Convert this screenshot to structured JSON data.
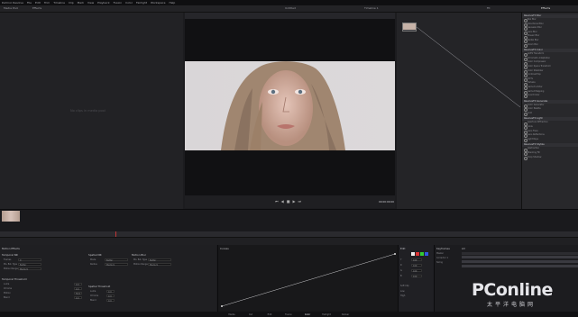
{
  "app": {
    "title": "DaVinci Resolve"
  },
  "menubar": {
    "items": [
      "DaVinci Resolve",
      "File",
      "Edit",
      "Trim",
      "Timeline",
      "Clip",
      "Mark",
      "View",
      "Playback",
      "Fusion",
      "Color",
      "Fairlight",
      "Workspace",
      "Help"
    ]
  },
  "toolbar": {
    "media_pool": "Media Pool",
    "effects": "Effects",
    "project_title": "Untitled",
    "timeline_name": "Timeline 1",
    "zoom": "Fit",
    "fx_tab": "Effects"
  },
  "left_panel": {
    "empty_text": "No clips in media pool"
  },
  "viewer": {
    "timecode": "00:00:00:00"
  },
  "effects_panel": {
    "sections": [
      {
        "title": "ResolveFX Blur",
        "items": [
          "Box Blur",
          "Directional Blur",
          "Gaussian Blur",
          "Lens Blur",
          "Mosaic Blur",
          "Radial Blur",
          "Zoom Blur"
        ]
      },
      {
        "title": "ResolveFX Color",
        "items": [
          "ACES Transform",
          "Chromatic Adaptation",
          "Color Compressor",
          "Color Space Transform",
          "Color Stabilizer",
          "Contrast Pop",
          "DCTL",
          "Dehaze",
          "Gamut Limiter",
          "Gamut Mapping",
          "Invert Color"
        ]
      },
      {
        "title": "ResolveFX Generate",
        "items": [
          "Color Generator",
          "Color Palette",
          "Grid"
        ]
      },
      {
        "title": "ResolveFX Light",
        "items": [
          "Aperture Diffraction",
          "Glow",
          "Lens Flare",
          "Lens Reflections",
          "Light Rays"
        ]
      },
      {
        "title": "ResolveFX Stylize",
        "items": [
          "Abstraction",
          "Blanking Fill",
          "Drop Shadow"
        ]
      }
    ]
  },
  "inspector": {
    "title": "Motion Effects",
    "groups": [
      {
        "title": "Temporal NR",
        "labels": [
          "Frames",
          "Mo. Est. Type",
          "Motion Range"
        ],
        "values": [
          "0",
          "Better",
          "Medium"
        ]
      },
      {
        "title": "Spatial NR",
        "labels": [
          "Mode",
          "Radius"
        ],
        "values": [
          "Better",
          "Medium"
        ]
      },
      {
        "title": "Motion Blur",
        "labels": [
          "Mo. Est. Type",
          "Motion Range"
        ],
        "values": [
          "Better",
          "Medium"
        ]
      }
    ],
    "temporal_threshold": {
      "title": "Temporal Threshold",
      "labels": [
        "Luma",
        "Chroma",
        "Motion",
        "Blend"
      ],
      "values": [
        "0.0",
        "0.0",
        "50.0",
        "0.0"
      ]
    },
    "spatial_threshold": {
      "title": "Spatial Threshold",
      "labels": [
        "Luma",
        "Chroma",
        "Blend"
      ],
      "values": [
        "0.0",
        "0.0",
        "0.0"
      ]
    }
  },
  "curves": {
    "title": "Curves"
  },
  "sliders": {
    "title": "Edit",
    "labels": [
      "Y",
      "R",
      "G",
      "B"
    ],
    "values": [
      "100",
      "100",
      "100",
      "100"
    ],
    "soft_clip": "Soft Clip",
    "low": "Low",
    "high": "High"
  },
  "keyframes": {
    "title": "Keyframes",
    "mode": "All",
    "rows": [
      "Master",
      "Corrector 1",
      "Sizing"
    ]
  },
  "pages": [
    "Media",
    "Cut",
    "Edit",
    "Fusion",
    "Color",
    "Fairlight",
    "Deliver"
  ],
  "watermark": {
    "logo": "PConline",
    "tagline": "太平洋电脑网"
  },
  "colors": {
    "accent": "#c03535",
    "bg": "#1c1c1f"
  }
}
